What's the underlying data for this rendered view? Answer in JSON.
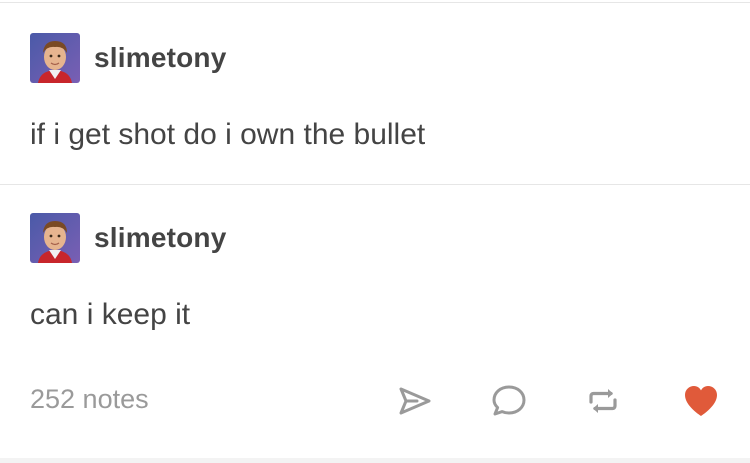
{
  "posts": [
    {
      "username": "slimetony",
      "avatar_icon": "child-portrait-avatar",
      "text": "if i get shot do i own the bullet"
    },
    {
      "username": "slimetony",
      "avatar_icon": "child-portrait-avatar",
      "text": "can i keep it"
    }
  ],
  "footer": {
    "notes": "252 notes",
    "actions": [
      {
        "name": "share",
        "icon": "paper-plane-icon"
      },
      {
        "name": "reply",
        "icon": "speech-bubble-icon"
      },
      {
        "name": "reblog",
        "icon": "reblog-arrows-icon"
      },
      {
        "name": "like",
        "icon": "heart-icon",
        "active": true
      }
    ]
  },
  "colors": {
    "text": "#444444",
    "muted": "#9a9a9a",
    "icon": "#9a9a9a",
    "heart": "#e05a3a",
    "divider": "#e6e6e6"
  }
}
